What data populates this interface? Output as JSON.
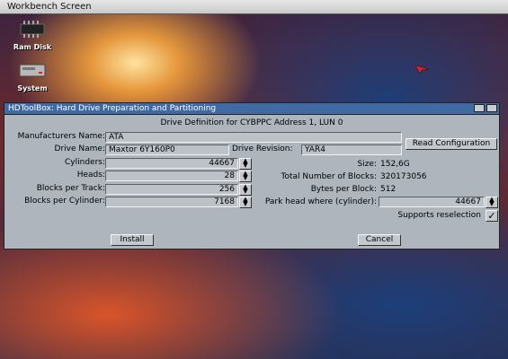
{
  "screen": {
    "title": "Workbench Screen"
  },
  "desktop": {
    "icons": [
      {
        "label": "Ram Disk",
        "icon": "ram-chip-icon"
      },
      {
        "label": "System",
        "icon": "hard-drive-icon"
      }
    ]
  },
  "window": {
    "title": "HDToolBox: Hard Drive Preparation and Partitioning",
    "heading": "Drive Definition for CYBPPC Address 1, LUN 0",
    "manufacturer": {
      "label": "Manufacturers Name:",
      "value": "ATA"
    },
    "drive_name": {
      "label": "Drive Name:",
      "value": "Maxtor    6Y160P0"
    },
    "drive_revision": {
      "label": "Drive Revision:",
      "value": "YAR4"
    },
    "read_config_label": "Read Configuration",
    "cylinders": {
      "label": "Cylinders:",
      "value": "44667"
    },
    "heads": {
      "label": "Heads:",
      "value": "28"
    },
    "blocks_per_track": {
      "label": "Blocks per Track:",
      "value": "256"
    },
    "blocks_per_cylinder": {
      "label": "Blocks per Cylinder:",
      "value": "7168"
    },
    "size": {
      "label": "Size:",
      "value": "152,6G"
    },
    "total_blocks": {
      "label": "Total Number of Blocks:",
      "value": "320173056"
    },
    "bytes_per_block": {
      "label": "Bytes per Block:",
      "value": "512"
    },
    "park_head": {
      "label": "Park head where (cylinder):",
      "value": "44667"
    },
    "supports_reselection": {
      "label": "Supports reselection",
      "checked": true
    },
    "install_label": "Install",
    "cancel_label": "Cancel"
  },
  "colors": {
    "title_bar": "#3f6aa4",
    "window_bg": "#aeb5bd",
    "screen_bar": "#d6d6d6"
  }
}
